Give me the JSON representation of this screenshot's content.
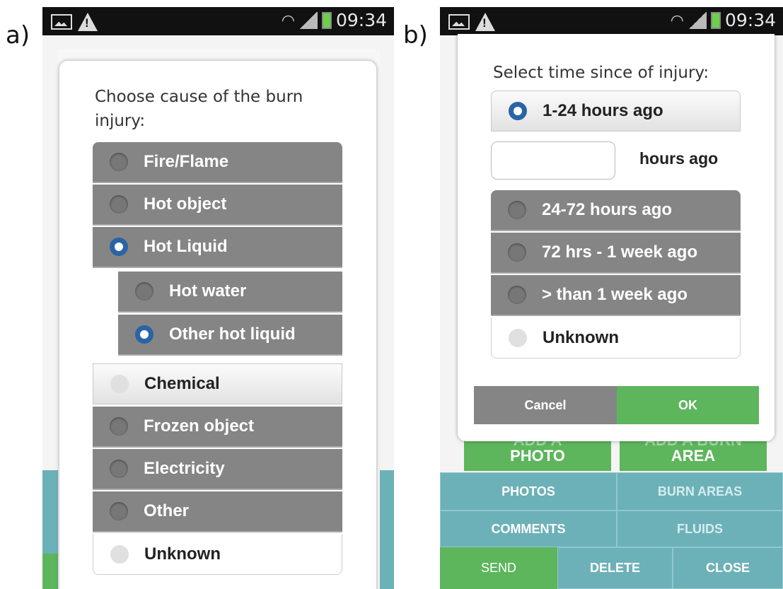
{
  "panel_a": {
    "label": "a)",
    "status": {
      "time": "09:34"
    },
    "prompt": "Choose cause of the burn injury:",
    "options": [
      {
        "label": "Fire/Flame",
        "selected": false
      },
      {
        "label": "Hot object",
        "selected": false
      },
      {
        "label": "Hot Liquid",
        "selected": true
      },
      {
        "label": "Hot water",
        "selected": false
      },
      {
        "label": "Other hot liquid",
        "selected": true
      },
      {
        "label": "Chemical",
        "selected": false
      },
      {
        "label": "Frozen object",
        "selected": false
      },
      {
        "label": "Electricity",
        "selected": false
      },
      {
        "label": "Other",
        "selected": false
      },
      {
        "label": "Unknown",
        "selected": false
      }
    ]
  },
  "panel_b": {
    "label": "b)",
    "status": {
      "time": "09:34"
    },
    "prompt": "Select time since of injury:",
    "options": [
      {
        "label": "1-24 hours ago",
        "selected": true
      },
      {
        "label": "24-72 hours ago",
        "selected": false
      },
      {
        "label": "72 hrs - 1 week ago",
        "selected": false
      },
      {
        "label": "> than 1 week ago",
        "selected": false
      },
      {
        "label": "Unknown",
        "selected": false
      }
    ],
    "hours_input": {
      "value": "",
      "suffix": "hours ago"
    },
    "cancel_label": "Cancel",
    "ok_label": "OK",
    "background": {
      "add_photo_line1": "ADD A",
      "add_photo_line2": "PHOTO",
      "add_area_line1": "ADD A BURN",
      "add_area_line2": "AREA",
      "photos": "PHOTOS",
      "burn_areas": "BURN AREAS",
      "comments": "COMMENTS",
      "fluids": "FLUIDS",
      "send": "SEND",
      "delete": "DELETE",
      "close": "CLOSE"
    }
  },
  "colors": {
    "accent_blue": "#2a64a6",
    "green": "#5db55c",
    "teal": "#6cb1b8",
    "gray_option": "#858585"
  }
}
